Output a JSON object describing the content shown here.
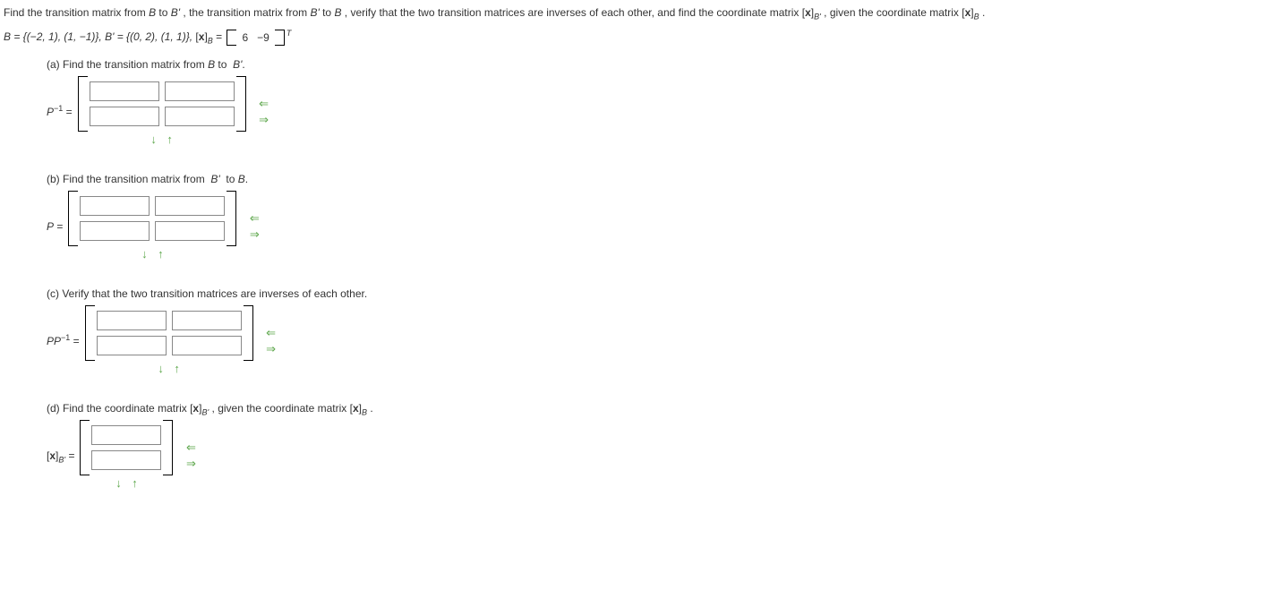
{
  "stem": {
    "text_before_1": "Find the transition matrix from ",
    "B": "B",
    "to": " to ",
    "Bprime": "B'",
    "text_mid_1": ", the transition matrix from ",
    "text_mid_2": " to ",
    "verify": ", verify that the two transition matrices are inverses of each other, and find the coordinate matrix ",
    "xBprime": "[x]",
    "xBprime_sub": "B'",
    "given": ", given the coordinate matrix ",
    "xB": "[x]",
    "xB_sub": "B",
    "period": "."
  },
  "given_line": {
    "B_eq": "B = {(−2, 1), (1, −1)}, ",
    "Bprime_eq": "B' = {(0, 2), (1, 1)},   ",
    "xB_label": "[x]",
    "xB_sub": "B",
    "equals": " = ",
    "v1": "6",
    "v2": "−9",
    "T": "T"
  },
  "parts": {
    "a": "(a) Find the transition matrix from B to  B'.",
    "b": "(b) Find the transition matrix from  B'  to B.",
    "c": "(c) Verify that the two transition matrices are inverses of each other.",
    "d_pre": "(d) Find the coordinate matrix ",
    "d_x1": "[x]",
    "d_x1_sub": "B'",
    "d_mid": ",  given the coordinate matrix ",
    "d_x2": "[x]",
    "d_x2_sub": "B",
    "d_end": "."
  },
  "labels": {
    "a": "P⁻¹ =",
    "a_html_pre": "P",
    "a_html_sup": "−1",
    "b": "P =",
    "c_pre": "PP",
    "c_sup": "−1",
    "d_pre": "[x]",
    "d_sub": "B'",
    "eq": " = "
  },
  "arrows": {
    "left": "⇐",
    "right": "⇒",
    "down": "↓",
    "up": "↑"
  }
}
